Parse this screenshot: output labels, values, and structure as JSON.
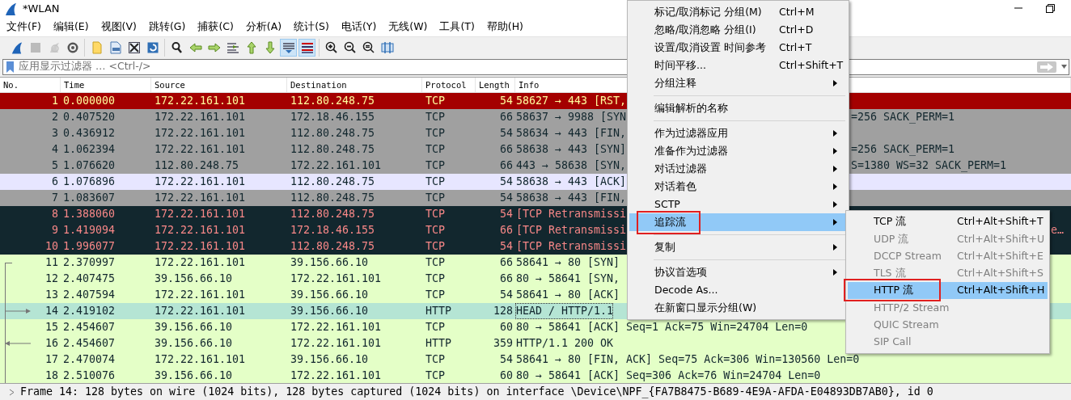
{
  "window": {
    "title": "*WLAN"
  },
  "menu_bar": [
    "文件(F)",
    "编辑(E)",
    "视图(V)",
    "跳转(G)",
    "捕获(C)",
    "分析(A)",
    "统计(S)",
    "电话(Y)",
    "无线(W)",
    "工具(T)",
    "帮助(H)"
  ],
  "toolbar_groups": [
    {
      "buttons": [
        {
          "on": false,
          "disabled": false
        },
        {
          "on": false,
          "disabled": true
        },
        {
          "on": false,
          "disabled": true
        },
        {
          "on": false,
          "disabled": false
        }
      ]
    },
    {
      "buttons": [
        {
          "on": false,
          "disabled": false
        },
        {
          "on": false,
          "disabled": false
        },
        {
          "on": false,
          "disabled": false
        },
        {
          "on": false,
          "disabled": false
        }
      ]
    },
    {
      "buttons": [
        {
          "on": false,
          "disabled": false
        },
        {
          "on": false,
          "disabled": false
        },
        {
          "on": false,
          "disabled": false
        },
        {
          "on": false,
          "disabled": false
        },
        {
          "on": false,
          "disabled": false
        },
        {
          "on": false,
          "disabled": false
        },
        {
          "on": true,
          "disabled": false
        },
        {
          "on": true,
          "disabled": false
        }
      ]
    },
    {
      "buttons": [
        {
          "on": false,
          "disabled": false
        },
        {
          "on": false,
          "disabled": false
        },
        {
          "on": false,
          "disabled": false
        },
        {
          "on": false,
          "disabled": false
        }
      ]
    }
  ],
  "filter": {
    "placeholder": "应用显示过滤器 … <Ctrl-/>"
  },
  "packet_list": {
    "columns": [
      "No.",
      "Time",
      "Source",
      "Destination",
      "Protocol",
      "Length",
      "Info"
    ],
    "rows": [
      {
        "no": "1",
        "time": "0.000000",
        "source": "172.22.161.101",
        "destination": "112.80.248.75",
        "protocol": "TCP",
        "length": "54",
        "info": "58627 → 443 [RST,",
        "kind": "rst",
        "selected": false
      },
      {
        "no": "2",
        "time": "0.407520",
        "source": "172.22.161.101",
        "destination": "172.18.46.155",
        "protocol": "TCP",
        "length": "66",
        "info": "58637 → 9988 [SYN",
        "info_tail": "=256 SACK_PERM=1",
        "tail_past_submenu": false,
        "kind": "gray",
        "selected": false
      },
      {
        "no": "3",
        "time": "0.436912",
        "source": "172.22.161.101",
        "destination": "112.80.248.75",
        "protocol": "TCP",
        "length": "54",
        "info": "58634 → 443 [FIN,",
        "kind": "gray",
        "selected": false
      },
      {
        "no": "4",
        "time": "1.062394",
        "source": "172.22.161.101",
        "destination": "112.80.248.75",
        "protocol": "TCP",
        "length": "66",
        "info": "58638 → 443 [SYN]",
        "info_tail": "=256 SACK_PERM=1",
        "tail_past_submenu": false,
        "kind": "gray",
        "selected": false
      },
      {
        "no": "5",
        "time": "1.076620",
        "source": "112.80.248.75",
        "destination": "172.22.161.101",
        "protocol": "TCP",
        "length": "66",
        "info": "443 → 58638 [SYN,",
        "info_tail": "S=1380 WS=32 SACK_PERM=1",
        "tail_past_submenu": false,
        "kind": "gray",
        "selected": false
      },
      {
        "no": "6",
        "time": "1.076896",
        "source": "172.22.161.101",
        "destination": "112.80.248.75",
        "protocol": "TCP",
        "length": "54",
        "info": "58638 → 443 [ACK]",
        "kind": "ack",
        "selected": false
      },
      {
        "no": "7",
        "time": "1.083607",
        "source": "172.22.161.101",
        "destination": "112.80.248.75",
        "protocol": "TCP",
        "length": "54",
        "info": "58638 → 443 [FIN,",
        "kind": "gray",
        "selected": false
      },
      {
        "no": "8",
        "time": "1.388060",
        "source": "172.22.161.101",
        "destination": "112.80.248.75",
        "protocol": "TCP",
        "length": "54",
        "info": "[TCP Retransmissi",
        "kind": "retrans",
        "selected": false
      },
      {
        "no": "9",
        "time": "1.419094",
        "source": "172.22.161.101",
        "destination": "172.18.46.155",
        "protocol": "TCP",
        "length": "66",
        "info": "[TCP Retransmissi",
        "info_tail": "e…",
        "tail_past_submenu": true,
        "kind": "retrans",
        "selected": false
      },
      {
        "no": "10",
        "time": "1.996077",
        "source": "172.22.161.101",
        "destination": "112.80.248.75",
        "protocol": "TCP",
        "length": "54",
        "info": "[TCP Retransmissi",
        "kind": "retrans",
        "selected": false
      },
      {
        "no": "11",
        "time": "2.370997",
        "source": "172.22.161.101",
        "destination": "39.156.66.10",
        "protocol": "TCP",
        "length": "66",
        "info": "58641 → 80 [SYN]",
        "kind": "http",
        "conversation": {
          "first": true,
          "request": false,
          "response": false
        },
        "selected": false
      },
      {
        "no": "12",
        "time": "2.407475",
        "source": "39.156.66.10",
        "destination": "172.22.161.101",
        "protocol": "TCP",
        "length": "66",
        "info": "80 → 58641 [SYN,",
        "kind": "http",
        "conversation": {
          "first": false,
          "request": false,
          "response": false
        },
        "selected": false
      },
      {
        "no": "13",
        "time": "2.407594",
        "source": "172.22.161.101",
        "destination": "39.156.66.10",
        "protocol": "TCP",
        "length": "54",
        "info": "58641 → 80 [ACK]",
        "kind": "http",
        "conversation": {
          "first": false,
          "request": false,
          "response": false
        },
        "selected": false
      },
      {
        "no": "14",
        "time": "2.419102",
        "source": "172.22.161.101",
        "destination": "39.156.66.10",
        "protocol": "HTTP",
        "length": "128",
        "info": "HEAD / HTTP/1.1",
        "kind": "http",
        "conversation": {
          "first": false,
          "request": true,
          "response": false
        },
        "selected": true
      },
      {
        "no": "15",
        "time": "2.454607",
        "source": "39.156.66.10",
        "destination": "172.22.161.101",
        "protocol": "TCP",
        "length": "60",
        "info": "80 → 58641 [ACK] Seq=1 Ack=75 Win=24704 Len=0",
        "kind": "http",
        "conversation": {
          "first": false,
          "request": false,
          "response": false
        },
        "selected": false
      },
      {
        "no": "16",
        "time": "2.454607",
        "source": "39.156.66.10",
        "destination": "172.22.161.101",
        "protocol": "HTTP",
        "length": "359",
        "info": "HTTP/1.1 200 OK",
        "kind": "http",
        "conversation": {
          "first": false,
          "request": false,
          "response": true
        },
        "selected": false
      },
      {
        "no": "17",
        "time": "2.470074",
        "source": "172.22.161.101",
        "destination": "39.156.66.10",
        "protocol": "TCP",
        "length": "54",
        "info": "58641 → 80 [FIN, ACK] Seq=75 Ack=306 Win=130560 Len=0",
        "kind": "http",
        "conversation": {
          "first": false,
          "request": false,
          "response": false
        },
        "selected": false
      },
      {
        "no": "18",
        "time": "2.510076",
        "source": "39.156.66.10",
        "destination": "172.22.161.101",
        "protocol": "TCP",
        "length": "60",
        "info": "80 → 58641 [ACK] Seq=306 Ack=76 Win=24704 Len=0",
        "kind": "http",
        "conversation": {
          "first": false,
          "request": false,
          "response": false
        },
        "selected": false
      }
    ]
  },
  "details": {
    "expanded": false,
    "text": "Frame 14: 128 bytes on wire (1024 bits), 128 bytes captured (1024 bits) on interface \\Device\\NPF_{FA7B8475-B689-4E9A-AFDA-E04893DB7AB0}, id 0"
  },
  "context_menu": {
    "items": [
      {
        "kind": "item",
        "label": "标记/取消标记 分组(M)",
        "shortcut": "Ctrl+M",
        "submenu": false,
        "selected": false,
        "annotated": false
      },
      {
        "kind": "item",
        "label": "忽略/取消忽略 分组(I)",
        "shortcut": "Ctrl+D",
        "submenu": false,
        "selected": false,
        "annotated": false
      },
      {
        "kind": "item",
        "label": "设置/取消设置 时间参考",
        "shortcut": "Ctrl+T",
        "submenu": false,
        "selected": false,
        "annotated": false
      },
      {
        "kind": "item",
        "label": "时间平移...",
        "shortcut": "Ctrl+Shift+T",
        "submenu": false,
        "selected": false,
        "annotated": false
      },
      {
        "kind": "item",
        "label": "分组注释",
        "submenu": true,
        "selected": false,
        "annotated": false
      },
      {
        "kind": "separator"
      },
      {
        "kind": "item",
        "label": "编辑解析的名称",
        "submenu": false,
        "selected": false,
        "annotated": false
      },
      {
        "kind": "separator"
      },
      {
        "kind": "item",
        "label": "作为过滤器应用",
        "submenu": true,
        "selected": false,
        "annotated": false
      },
      {
        "kind": "item",
        "label": "准备作为过滤器",
        "submenu": true,
        "selected": false,
        "annotated": false
      },
      {
        "kind": "item",
        "label": "对话过滤器",
        "submenu": true,
        "selected": false,
        "annotated": false
      },
      {
        "kind": "item",
        "label": "对话着色",
        "submenu": true,
        "selected": false,
        "annotated": false
      },
      {
        "kind": "item",
        "label": "SCTP",
        "submenu": true,
        "selected": false,
        "annotated": false
      },
      {
        "kind": "item",
        "label": "追踪流",
        "submenu": true,
        "selected": true,
        "annotated": true
      },
      {
        "kind": "separator"
      },
      {
        "kind": "item",
        "label": "复制",
        "submenu": true,
        "selected": false,
        "annotated": false
      },
      {
        "kind": "separator"
      },
      {
        "kind": "item",
        "label": "协议首选项",
        "submenu": true,
        "selected": false,
        "annotated": false
      },
      {
        "kind": "item",
        "label": "Decode As...",
        "submenu": false,
        "selected": false,
        "annotated": false
      },
      {
        "kind": "item",
        "label": "在新窗口显示分组(W)",
        "submenu": false,
        "selected": false,
        "annotated": false
      }
    ]
  },
  "submenu": {
    "items": [
      {
        "label": "TCP 流",
        "shortcut": "Ctrl+Alt+Shift+T",
        "disabled": false,
        "selected": false,
        "annotated": false
      },
      {
        "label": "UDP 流",
        "shortcut": "Ctrl+Alt+Shift+U",
        "disabled": true,
        "selected": false,
        "annotated": false
      },
      {
        "label": "DCCP Stream",
        "shortcut": "Ctrl+Alt+Shift+E",
        "disabled": true,
        "selected": false,
        "annotated": false
      },
      {
        "label": "TLS 流",
        "shortcut": "Ctrl+Alt+Shift+S",
        "disabled": true,
        "selected": false,
        "annotated": false
      },
      {
        "label": "HTTP 流",
        "shortcut": "Ctrl+Alt+Shift+H",
        "disabled": false,
        "selected": true,
        "annotated": true
      },
      {
        "label": "HTTP/2 Stream",
        "disabled": true,
        "selected": false,
        "annotated": false
      },
      {
        "label": "QUIC Stream",
        "disabled": true,
        "selected": false,
        "annotated": false
      },
      {
        "label": "SIP Call",
        "disabled": true,
        "selected": false,
        "annotated": false
      }
    ]
  }
}
